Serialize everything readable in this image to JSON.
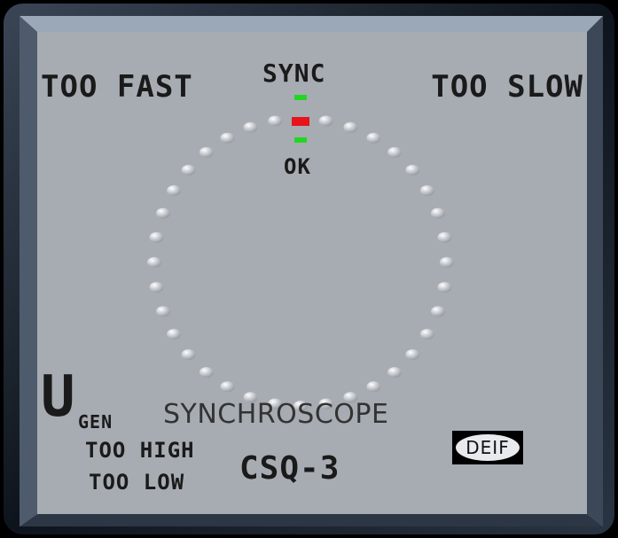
{
  "labels": {
    "too_fast": "TOO FAST",
    "too_slow": "TOO SLOW",
    "sync": "SYNC",
    "ok": "OK",
    "u": "U",
    "gen": "GEN",
    "title": "SYNCHROSCOPE",
    "too_high": "TOO HIGH",
    "too_low": "TOO LOW",
    "model": "CSQ-3",
    "brand": "DEIF"
  },
  "indicators": {
    "lit_segment": "top",
    "lit_color": "#e8141b",
    "sync_band_color": "#22d622",
    "led_count": 36
  },
  "colors": {
    "face": "#a7acb3",
    "bezel": "#1b2430",
    "text": "#1a1a1a"
  }
}
